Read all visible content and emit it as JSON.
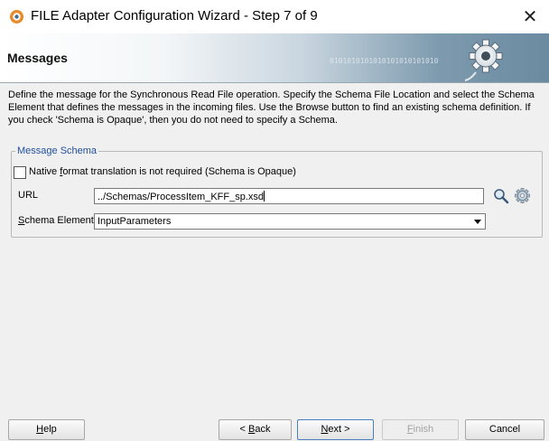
{
  "window": {
    "title": "FILE Adapter Configuration Wizard - Step 7 of 9",
    "close_glyph": "✕"
  },
  "header": {
    "title": "Messages",
    "binary_decoration": "0101010101010101010101010",
    "icon": "gear-icon"
  },
  "description": "Define the message for the Synchronous Read File operation.  Specify the Schema File Location and select the Schema Element that defines the messages in the incoming files. Use the Browse button to find an existing schema definition. If you check 'Schema is Opaque', then you do not need to specify a Schema.",
  "message_schema": {
    "legend": "Message Schema",
    "opaque_checkbox": {
      "label_prefix": "Native ",
      "label_mnemonic": "f",
      "label_suffix": "ormat translation is not required (Schema is Opaque)",
      "checked": false
    },
    "url": {
      "label": "URL",
      "value": "../Schemas/ProcessItem_KFF_sp.xsd"
    },
    "schema_element": {
      "label_mnemonic": "S",
      "label_suffix": "chema Element",
      "selected": "InputParameters"
    }
  },
  "buttons": {
    "help": {
      "mnemonic": "H",
      "rest": "elp"
    },
    "back": {
      "prefix": "< ",
      "mnemonic": "B",
      "rest": "ack"
    },
    "next": {
      "mnemonic": "N",
      "rest": "ext >"
    },
    "finish": {
      "mnemonic": "F",
      "rest": "inish",
      "enabled": false
    },
    "cancel": {
      "label": "Cancel"
    }
  },
  "colors": {
    "legend": "#1f4f9c",
    "banner_dark": "#6b8aa0",
    "app_icon_orange": "#e8892a"
  }
}
